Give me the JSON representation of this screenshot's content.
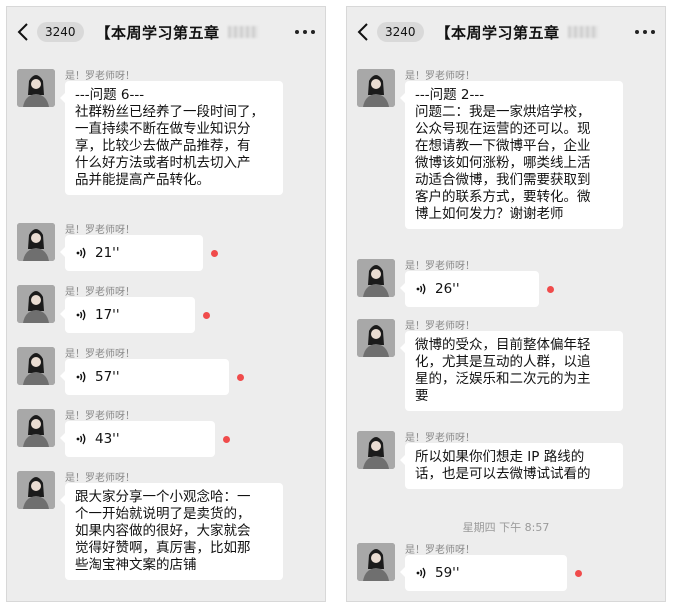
{
  "left": {
    "header": {
      "unread_count": "3240",
      "title": "【本周学习第五章"
    },
    "messages": [
      {
        "sender": "是！罗老师呀！",
        "text": "---问题 6---\n社群粉丝已经养了一段时间了，\n一直持续不断在做专业知识分\n享，比较少去做产品推荐，有\n什么好方法或者时机去切入产\n品并能提高产品转化。"
      },
      {
        "sender": "是！罗老师呀！",
        "duration": "21''"
      },
      {
        "sender": "是！罗老师呀！",
        "duration": "17''"
      },
      {
        "sender": "是！罗老师呀！",
        "duration": "57''"
      },
      {
        "sender": "是！罗老师呀！",
        "duration": "43''"
      },
      {
        "sender": "是！罗老师呀！",
        "text": "跟大家分享一个小观念哈：一\n个一开始就说明了是卖货的，\n如果内容做的很好，大家就会\n觉得好赞啊，真厉害，比如那\n些淘宝神文案的店铺"
      }
    ]
  },
  "right": {
    "header": {
      "unread_count": "3240",
      "title": "【本周学习第五章"
    },
    "messages": [
      {
        "sender": "是！罗老师呀！",
        "text": "---问题 2---\n问题二：我是一家烘焙学校，\n公众号现在运营的还可以。现\n在想请教一下微博平台，企业\n微博该如何涨粉，哪类线上活\n动适合微博，我们需要获取到\n客户的联系方式，要转化。微\n博上如何发力？谢谢老师"
      },
      {
        "sender": "是！罗老师呀！",
        "duration": "26''"
      },
      {
        "sender": "是！罗老师呀！",
        "text": "微博的受众，目前整体偏年轻\n化，尤其是互动的人群，以追\n星的，泛娱乐和二次元的为主\n要"
      },
      {
        "sender": "是！罗老师呀！",
        "text": "所以如果你们想走 IP 路线的\n话，也是可以去微博试试看的"
      },
      {
        "sender": "是！罗老师呀！",
        "duration": "59''"
      }
    ],
    "timestamp": "星期四 下午 8:57"
  },
  "icons": {
    "back": "chevron-left-icon",
    "more": "more-dots-icon",
    "voice": "voice-wave-icon",
    "unread": "red-dot"
  },
  "colors": {
    "background": "#ededed",
    "bubble": "#ffffff",
    "unread_dot": "#f04b4b",
    "meta_text": "#8a8a8a"
  }
}
